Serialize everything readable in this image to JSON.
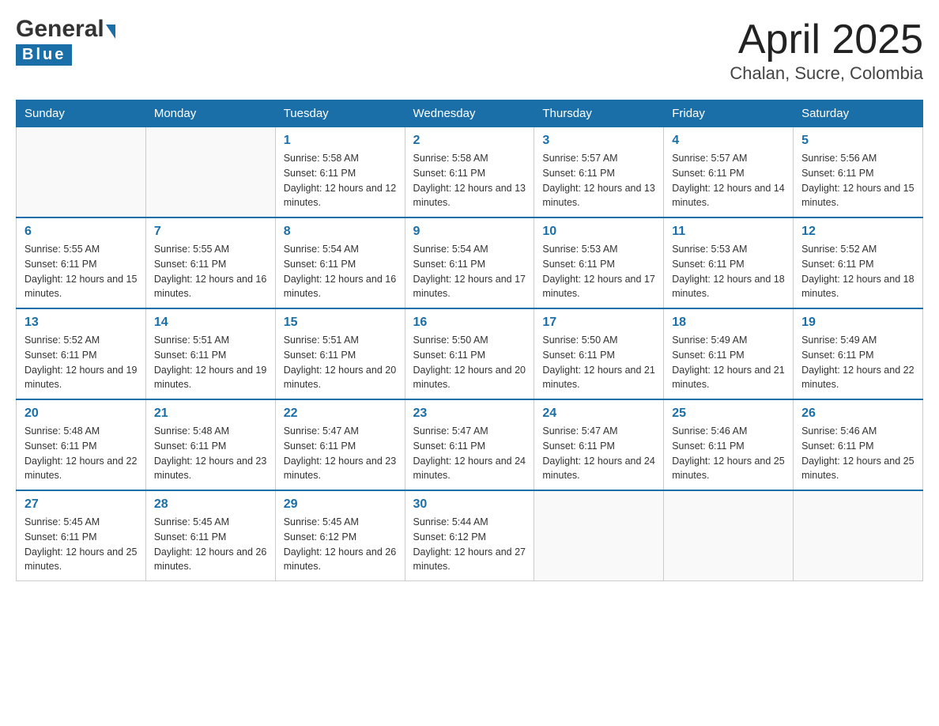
{
  "header": {
    "logo_general": "General",
    "logo_blue": "Blue",
    "title": "April 2025",
    "subtitle": "Chalan, Sucre, Colombia"
  },
  "columns": [
    "Sunday",
    "Monday",
    "Tuesday",
    "Wednesday",
    "Thursday",
    "Friday",
    "Saturday"
  ],
  "weeks": [
    [
      {
        "day": "",
        "sunrise": "",
        "sunset": "",
        "daylight": ""
      },
      {
        "day": "",
        "sunrise": "",
        "sunset": "",
        "daylight": ""
      },
      {
        "day": "1",
        "sunrise": "Sunrise: 5:58 AM",
        "sunset": "Sunset: 6:11 PM",
        "daylight": "Daylight: 12 hours and 12 minutes."
      },
      {
        "day": "2",
        "sunrise": "Sunrise: 5:58 AM",
        "sunset": "Sunset: 6:11 PM",
        "daylight": "Daylight: 12 hours and 13 minutes."
      },
      {
        "day": "3",
        "sunrise": "Sunrise: 5:57 AM",
        "sunset": "Sunset: 6:11 PM",
        "daylight": "Daylight: 12 hours and 13 minutes."
      },
      {
        "day": "4",
        "sunrise": "Sunrise: 5:57 AM",
        "sunset": "Sunset: 6:11 PM",
        "daylight": "Daylight: 12 hours and 14 minutes."
      },
      {
        "day": "5",
        "sunrise": "Sunrise: 5:56 AM",
        "sunset": "Sunset: 6:11 PM",
        "daylight": "Daylight: 12 hours and 15 minutes."
      }
    ],
    [
      {
        "day": "6",
        "sunrise": "Sunrise: 5:55 AM",
        "sunset": "Sunset: 6:11 PM",
        "daylight": "Daylight: 12 hours and 15 minutes."
      },
      {
        "day": "7",
        "sunrise": "Sunrise: 5:55 AM",
        "sunset": "Sunset: 6:11 PM",
        "daylight": "Daylight: 12 hours and 16 minutes."
      },
      {
        "day": "8",
        "sunrise": "Sunrise: 5:54 AM",
        "sunset": "Sunset: 6:11 PM",
        "daylight": "Daylight: 12 hours and 16 minutes."
      },
      {
        "day": "9",
        "sunrise": "Sunrise: 5:54 AM",
        "sunset": "Sunset: 6:11 PM",
        "daylight": "Daylight: 12 hours and 17 minutes."
      },
      {
        "day": "10",
        "sunrise": "Sunrise: 5:53 AM",
        "sunset": "Sunset: 6:11 PM",
        "daylight": "Daylight: 12 hours and 17 minutes."
      },
      {
        "day": "11",
        "sunrise": "Sunrise: 5:53 AM",
        "sunset": "Sunset: 6:11 PM",
        "daylight": "Daylight: 12 hours and 18 minutes."
      },
      {
        "day": "12",
        "sunrise": "Sunrise: 5:52 AM",
        "sunset": "Sunset: 6:11 PM",
        "daylight": "Daylight: 12 hours and 18 minutes."
      }
    ],
    [
      {
        "day": "13",
        "sunrise": "Sunrise: 5:52 AM",
        "sunset": "Sunset: 6:11 PM",
        "daylight": "Daylight: 12 hours and 19 minutes."
      },
      {
        "day": "14",
        "sunrise": "Sunrise: 5:51 AM",
        "sunset": "Sunset: 6:11 PM",
        "daylight": "Daylight: 12 hours and 19 minutes."
      },
      {
        "day": "15",
        "sunrise": "Sunrise: 5:51 AM",
        "sunset": "Sunset: 6:11 PM",
        "daylight": "Daylight: 12 hours and 20 minutes."
      },
      {
        "day": "16",
        "sunrise": "Sunrise: 5:50 AM",
        "sunset": "Sunset: 6:11 PM",
        "daylight": "Daylight: 12 hours and 20 minutes."
      },
      {
        "day": "17",
        "sunrise": "Sunrise: 5:50 AM",
        "sunset": "Sunset: 6:11 PM",
        "daylight": "Daylight: 12 hours and 21 minutes."
      },
      {
        "day": "18",
        "sunrise": "Sunrise: 5:49 AM",
        "sunset": "Sunset: 6:11 PM",
        "daylight": "Daylight: 12 hours and 21 minutes."
      },
      {
        "day": "19",
        "sunrise": "Sunrise: 5:49 AM",
        "sunset": "Sunset: 6:11 PM",
        "daylight": "Daylight: 12 hours and 22 minutes."
      }
    ],
    [
      {
        "day": "20",
        "sunrise": "Sunrise: 5:48 AM",
        "sunset": "Sunset: 6:11 PM",
        "daylight": "Daylight: 12 hours and 22 minutes."
      },
      {
        "day": "21",
        "sunrise": "Sunrise: 5:48 AM",
        "sunset": "Sunset: 6:11 PM",
        "daylight": "Daylight: 12 hours and 23 minutes."
      },
      {
        "day": "22",
        "sunrise": "Sunrise: 5:47 AM",
        "sunset": "Sunset: 6:11 PM",
        "daylight": "Daylight: 12 hours and 23 minutes."
      },
      {
        "day": "23",
        "sunrise": "Sunrise: 5:47 AM",
        "sunset": "Sunset: 6:11 PM",
        "daylight": "Daylight: 12 hours and 24 minutes."
      },
      {
        "day": "24",
        "sunrise": "Sunrise: 5:47 AM",
        "sunset": "Sunset: 6:11 PM",
        "daylight": "Daylight: 12 hours and 24 minutes."
      },
      {
        "day": "25",
        "sunrise": "Sunrise: 5:46 AM",
        "sunset": "Sunset: 6:11 PM",
        "daylight": "Daylight: 12 hours and 25 minutes."
      },
      {
        "day": "26",
        "sunrise": "Sunrise: 5:46 AM",
        "sunset": "Sunset: 6:11 PM",
        "daylight": "Daylight: 12 hours and 25 minutes."
      }
    ],
    [
      {
        "day": "27",
        "sunrise": "Sunrise: 5:45 AM",
        "sunset": "Sunset: 6:11 PM",
        "daylight": "Daylight: 12 hours and 25 minutes."
      },
      {
        "day": "28",
        "sunrise": "Sunrise: 5:45 AM",
        "sunset": "Sunset: 6:11 PM",
        "daylight": "Daylight: 12 hours and 26 minutes."
      },
      {
        "day": "29",
        "sunrise": "Sunrise: 5:45 AM",
        "sunset": "Sunset: 6:12 PM",
        "daylight": "Daylight: 12 hours and 26 minutes."
      },
      {
        "day": "30",
        "sunrise": "Sunrise: 5:44 AM",
        "sunset": "Sunset: 6:12 PM",
        "daylight": "Daylight: 12 hours and 27 minutes."
      },
      {
        "day": "",
        "sunrise": "",
        "sunset": "",
        "daylight": ""
      },
      {
        "day": "",
        "sunrise": "",
        "sunset": "",
        "daylight": ""
      },
      {
        "day": "",
        "sunrise": "",
        "sunset": "",
        "daylight": ""
      }
    ]
  ]
}
